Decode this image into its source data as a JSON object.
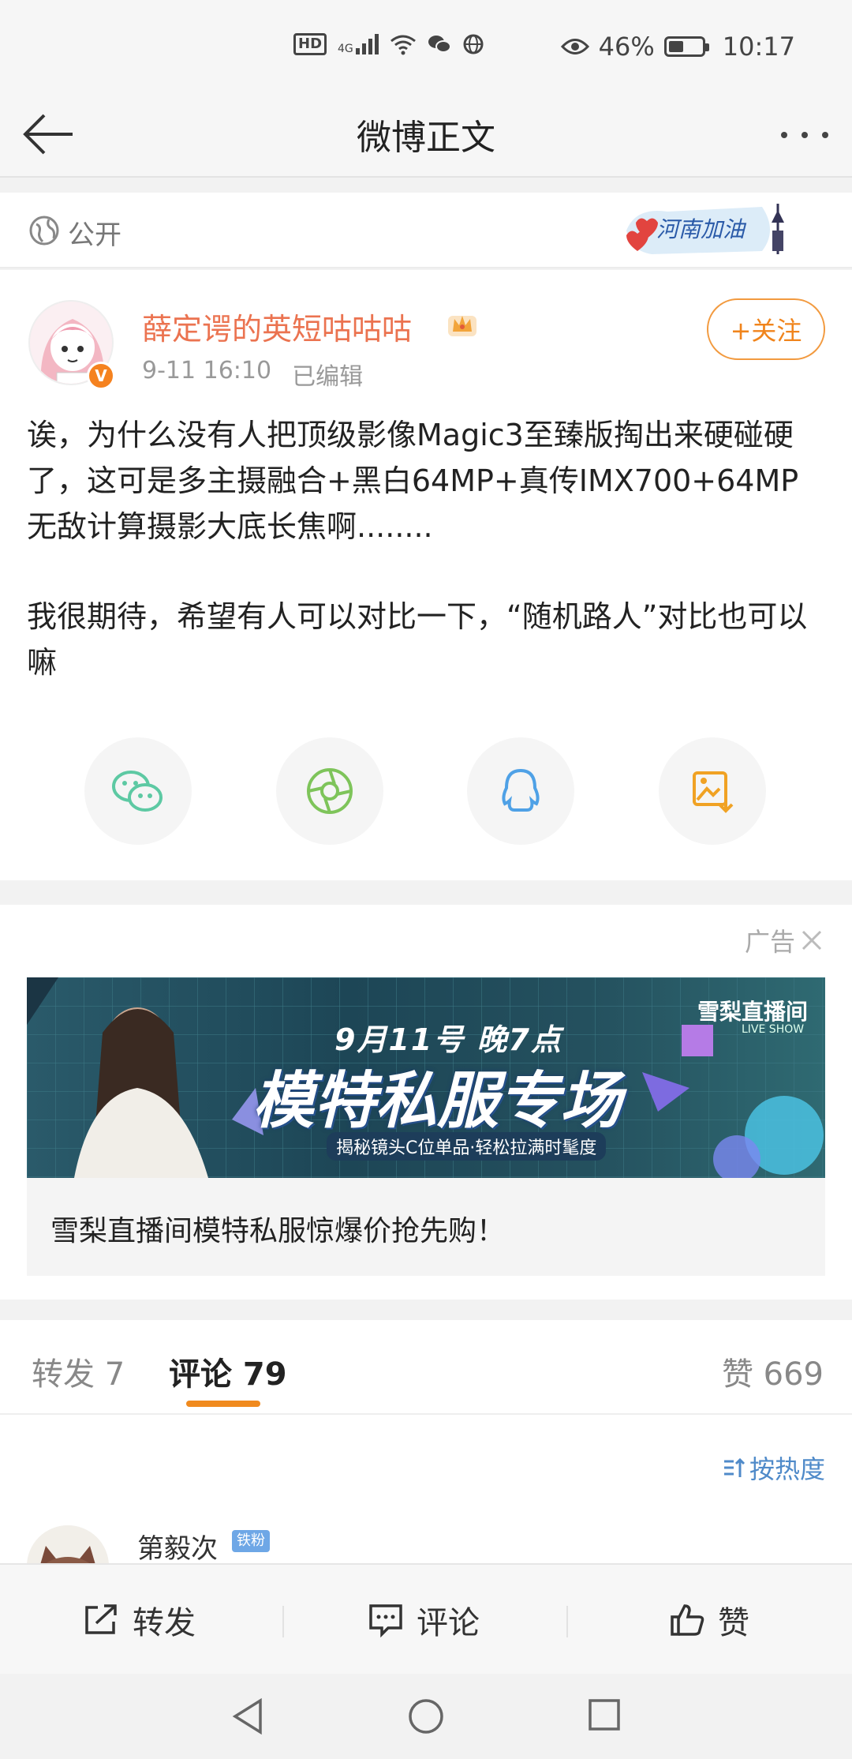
{
  "status_bar": {
    "hd": "HD",
    "network": "4G",
    "battery_text": "46%",
    "battery_level": 0.46,
    "time": "10:17"
  },
  "nav": {
    "title": "微博正文"
  },
  "visibility": {
    "label": "公开"
  },
  "post": {
    "username": "薛定谔的英短咕咕咕",
    "time": "9-11 16:10",
    "edited": "已编辑",
    "follow_label": "+关注",
    "paragraph1": "诶，为什么没有人把顶级影像Magic3至臻版掏出来硬碰硬了，这可是多主摄融合+黑白64MP+真传IMX700+64MP无敌计算摄影大底长焦啊........",
    "paragraph2": "我很期待，希望有人可以对比一下，“随机路人”对比也可以嘛",
    "share_icons": [
      "wechat-icon",
      "moments-icon",
      "qq-icon",
      "save-image-icon"
    ]
  },
  "ad": {
    "label": "广告",
    "banner_date": "9月11号 晚7点",
    "banner_title": "模特私服专场",
    "banner_sub": "揭秘镜头C位单品·轻松拉满时髦度",
    "banner_brand": "雪梨直播间",
    "banner_live": "LIVE SHOW",
    "caption": "雪梨直播间模特私服惊爆价抢先购！"
  },
  "tabs": {
    "repost": "转发 7",
    "comment": "评论 79",
    "like": "赞 669"
  },
  "comments": {
    "sort_label": "按热度",
    "first_name": "第毅次",
    "first_badge": "铁粉"
  },
  "actions": {
    "repost": "转发",
    "comment": "评论",
    "like": "赞"
  }
}
